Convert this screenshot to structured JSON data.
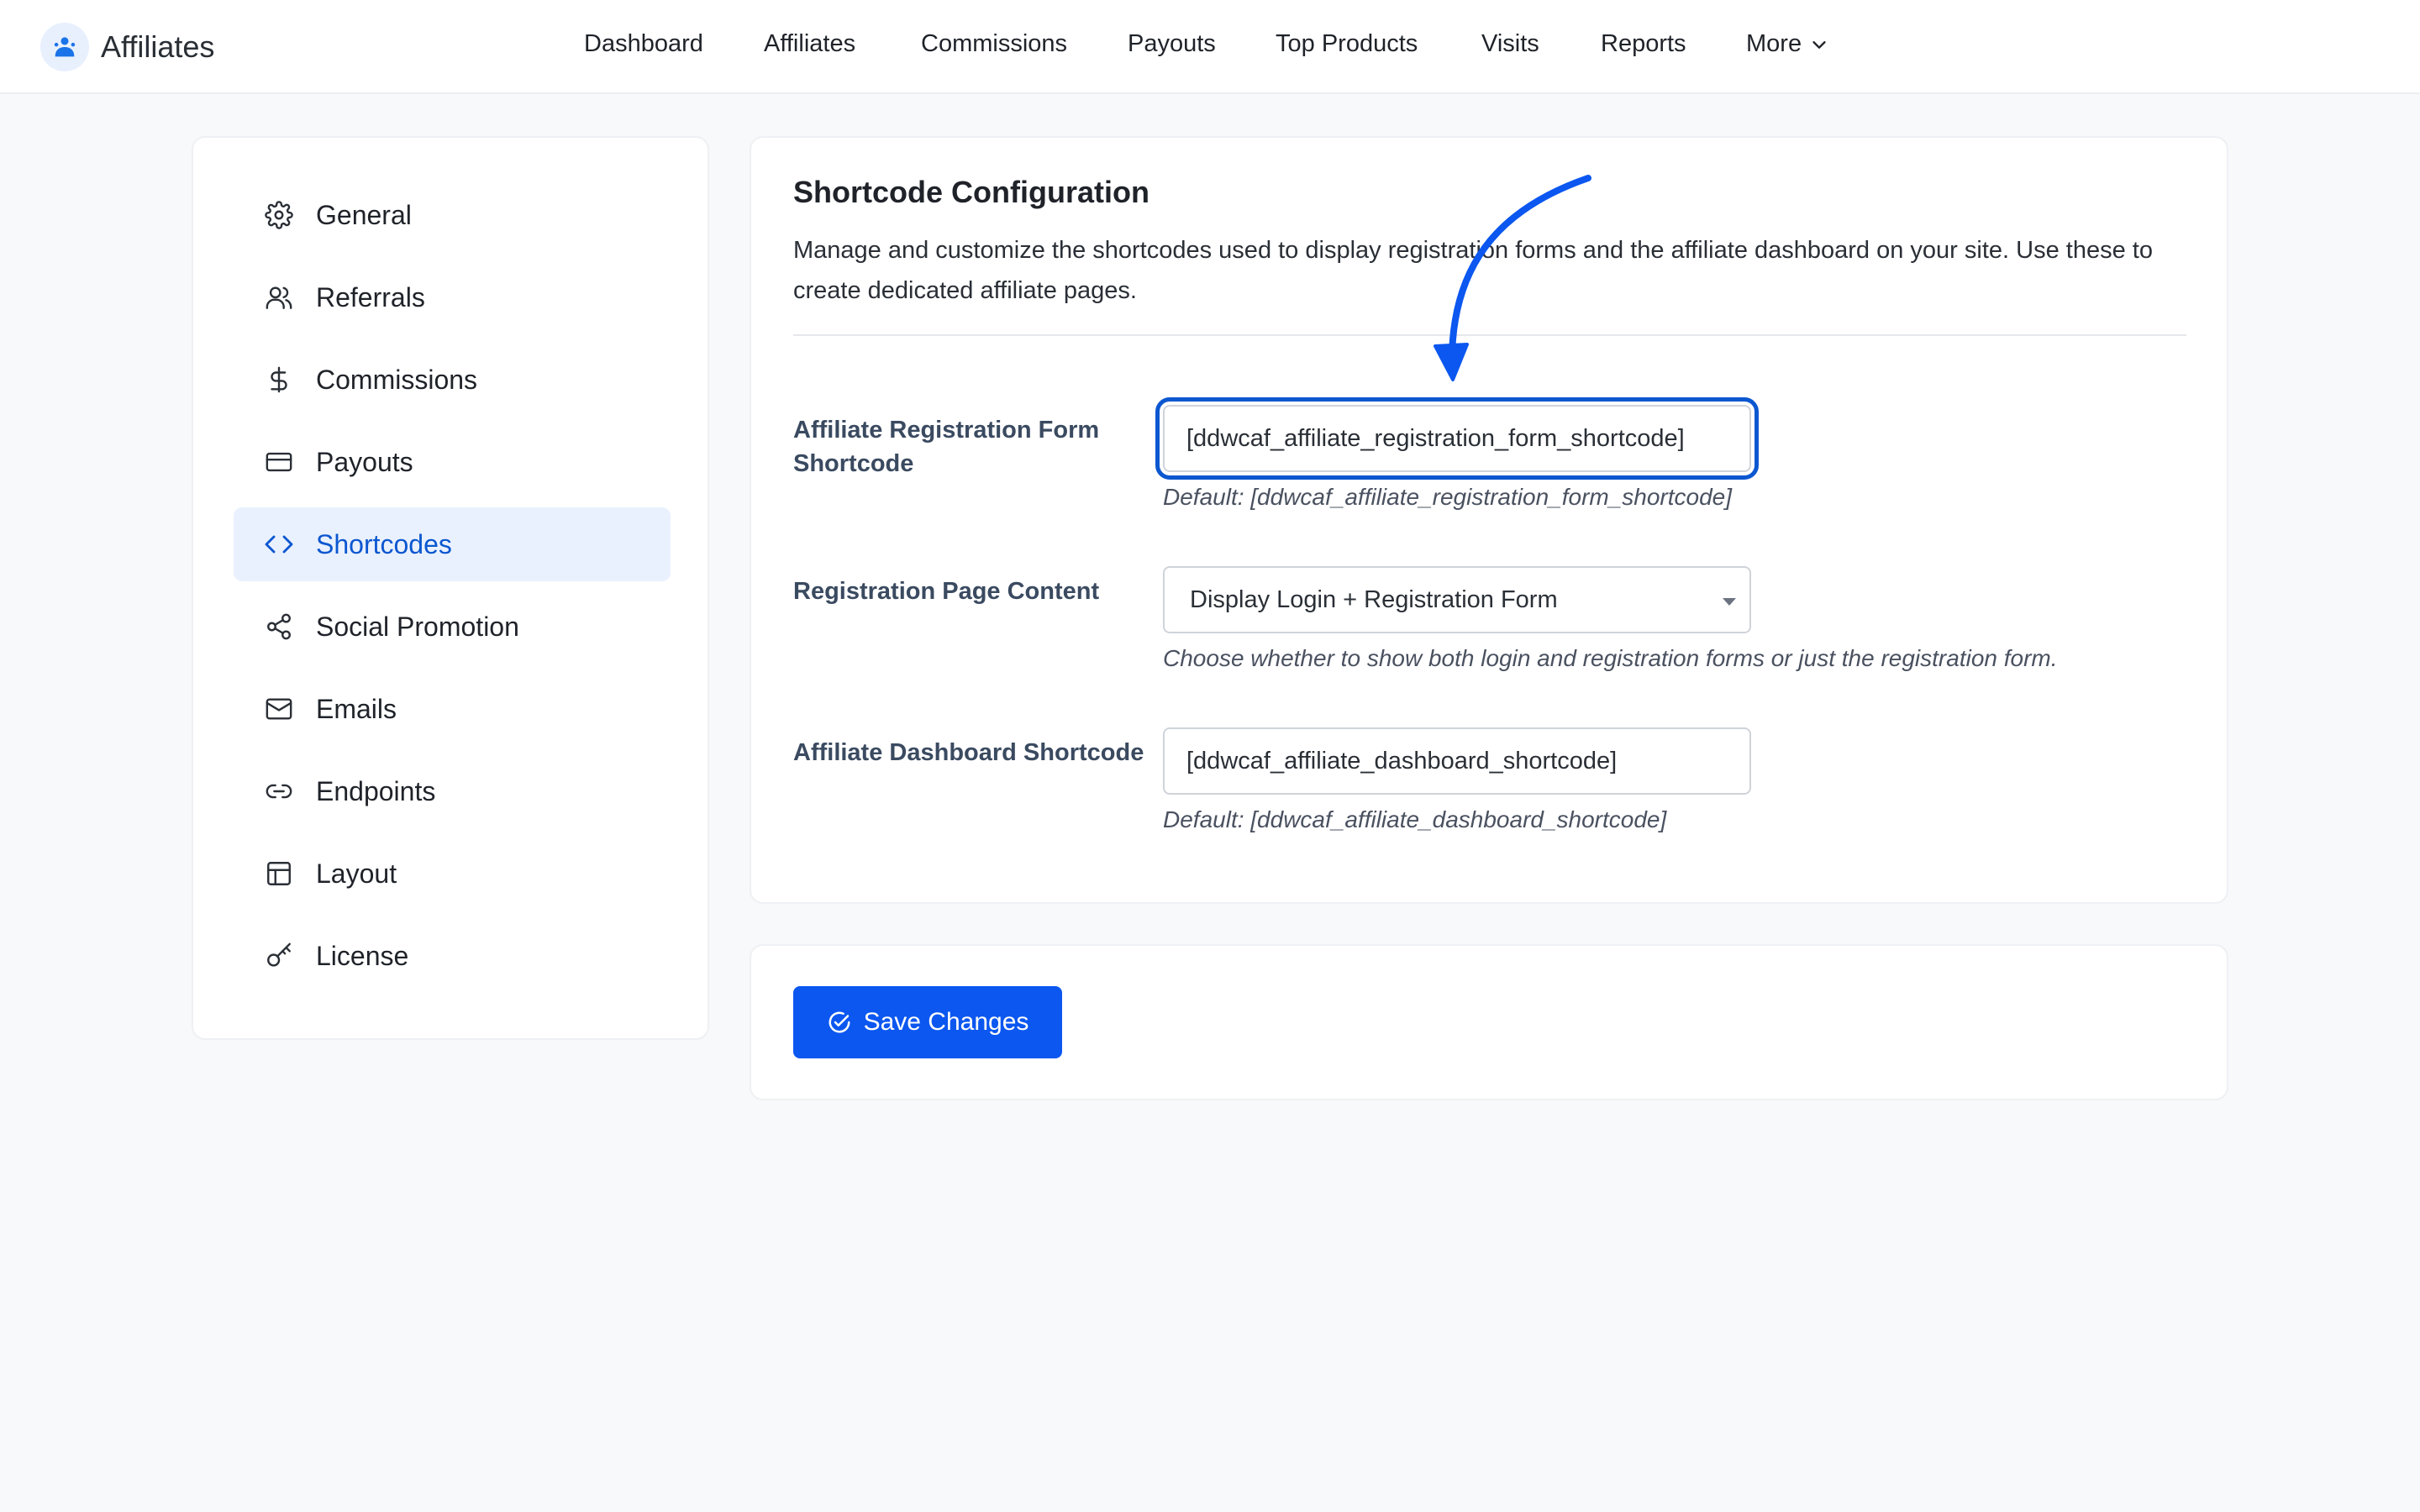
{
  "app": {
    "title": "Affiliates"
  },
  "nav": {
    "items": [
      "Dashboard",
      "Affiliates",
      "Commissions",
      "Payouts",
      "Top Products",
      "Visits",
      "Reports"
    ],
    "more_label": "More"
  },
  "sidebar": {
    "items": [
      {
        "label": "General",
        "icon": "gear-icon"
      },
      {
        "label": "Referrals",
        "icon": "users-icon"
      },
      {
        "label": "Commissions",
        "icon": "dollar-icon"
      },
      {
        "label": "Payouts",
        "icon": "card-icon"
      },
      {
        "label": "Shortcodes",
        "icon": "code-icon",
        "active": true
      },
      {
        "label": "Social Promotion",
        "icon": "share-icon"
      },
      {
        "label": "Emails",
        "icon": "mail-icon"
      },
      {
        "label": "Endpoints",
        "icon": "link-icon"
      },
      {
        "label": "Layout",
        "icon": "layout-icon"
      },
      {
        "label": "License",
        "icon": "key-icon"
      }
    ]
  },
  "main": {
    "title": "Shortcode Configuration",
    "description": "Manage and customize the shortcodes used to display registration forms and the affiliate dashboard on your site. Use these to create dedicated affiliate pages.",
    "fields": {
      "registration_shortcode": {
        "label": "Affiliate Registration Form Shortcode",
        "value": "[ddwcaf_affiliate_registration_form_shortcode]",
        "help": "Default: [ddwcaf_affiliate_registration_form_shortcode]"
      },
      "registration_content": {
        "label": "Registration Page Content",
        "selected": "Display Login + Registration Form",
        "help": "Choose whether to show both login and registration forms or just the registration form."
      },
      "dashboard_shortcode": {
        "label": "Affiliate Dashboard Shortcode",
        "value": "[ddwcaf_affiliate_dashboard_shortcode]",
        "help": "Default: [ddwcaf_affiliate_dashboard_shortcode]"
      }
    }
  },
  "actions": {
    "save_label": "Save Changes"
  },
  "colors": {
    "accent": "#0b57f0",
    "active_bg": "#eaf1fe",
    "annotation": "#0b57f0"
  }
}
